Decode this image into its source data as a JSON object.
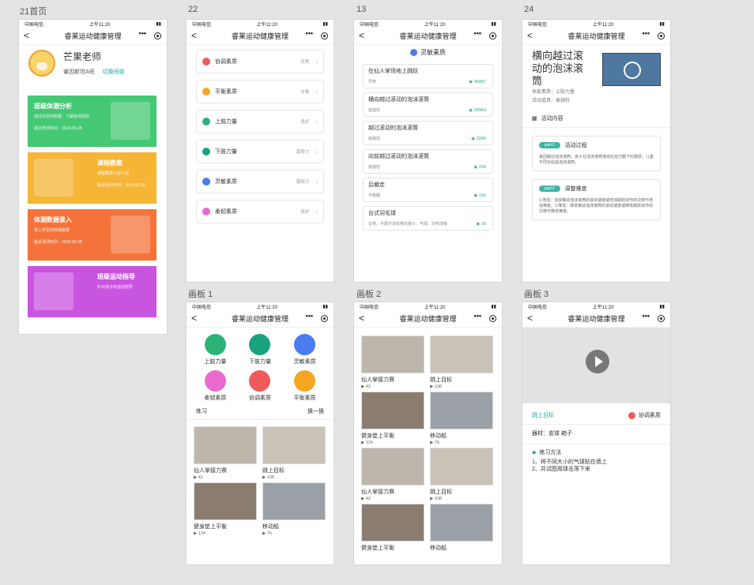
{
  "labels": {
    "home": "21首页",
    "p22": "22",
    "p13": "13",
    "p24": "24",
    "b1": "画板 1",
    "b2": "画板 2",
    "b3": "画板 3"
  },
  "status": {
    "carrier": "中国电信",
    "time": "上午11:20"
  },
  "nav": {
    "title": "睿莱运动健康管理",
    "back": "<",
    "more": "•••"
  },
  "home": {
    "teacher": "芒果老师",
    "class": "睿因斯坦A班",
    "switch": "切换班级",
    "cards": [
      {
        "title": "班级体测分析",
        "desc": "通过科学的数据，了解各项指标",
        "date": "最近测评时间：2018-05-28",
        "color": "#45c874"
      },
      {
        "title": "课程教案",
        "desc": "课程教案内容介绍",
        "date": "最近测评时间：2018-05-28",
        "color": "#f5b535"
      },
      {
        "title": "体测数据录入",
        "desc": "录入学生的体测数据",
        "date": "最近测评时间：2018-05-28",
        "color": "#f5733a"
      },
      {
        "title": "班级运动指导",
        "desc": "针对孩子的运动指导",
        "date": "",
        "color": "#c855e0"
      }
    ]
  },
  "p22": {
    "items": [
      {
        "name": "协调素质",
        "val": "优秀",
        "color": "#f05a5a"
      },
      {
        "name": "平衡素质",
        "val": "合格",
        "color": "#f5a623"
      },
      {
        "name": "上肢力量",
        "val": "良好",
        "color": "#2db37a"
      },
      {
        "name": "下肢力量",
        "val": "需努力",
        "color": "#1aa37f"
      },
      {
        "name": "灵敏素质",
        "val": "需努力",
        "color": "#4a7cf0"
      },
      {
        "name": "柔韧素质",
        "val": "良好",
        "color": "#e96bd0"
      }
    ]
  },
  "p13": {
    "title": "灵敏素质",
    "items": [
      {
        "t": "在仙人掌场地上跳跃",
        "s": "导类",
        "v": "46887"
      },
      {
        "t": "横向越过滚动的泡沫滚筒",
        "s": "瑜伽柱",
        "v": "38964"
      },
      {
        "t": "越过滚动的泡沫滚筒",
        "s": "瑜伽柱",
        "v": "2996"
      },
      {
        "t": "向前越过滚动的泡沫滚筒",
        "s": "瑜伽柱",
        "v": "234"
      },
      {
        "t": "后撤走",
        "s": "平衡圈",
        "v": "156"
      },
      {
        "t": "台式羽毛球",
        "s": "长凳、平展方块软带的帽子、气球、羽毛球板",
        "v": "39"
      }
    ]
  },
  "p24": {
    "title": "横向越过滚动的泡沫滚筒",
    "meta1": "体能素质：上肢力量",
    "meta2": "活动道具：瑜伽柱",
    "sec": "活动内容",
    "parts": [
      {
        "tag": "part1",
        "name": "活动过程",
        "desc": "来回跳动泡沫滚筒，孩子在泡沫滚筒滚动在自己脚下时跳跃，儿童不同手段提泡沫滚筒。"
      },
      {
        "tag": "part2",
        "name": "调整难度",
        "desc": "1.增加：加快推动泡沫滚筒的滚动速度或增加跳跃动作的次数可增加难度。2.降低：降低推动泡沫滚筒的滚动速度或降低跳跃动作的次数可降低难度。"
      }
    ]
  },
  "b1": {
    "icons": [
      {
        "n": "上肢力量",
        "c": "#2db37a"
      },
      {
        "n": "下肢力量",
        "c": "#1aa37f"
      },
      {
        "n": "灵敏素质",
        "c": "#4a7cf0"
      },
      {
        "n": "柔韧素质",
        "c": "#e96bd0"
      },
      {
        "n": "协调素质",
        "c": "#f05a5a"
      },
      {
        "n": "平衡素质",
        "c": "#f5a623"
      }
    ],
    "prac": "练习",
    "refresh": "换一换",
    "videos": [
      {
        "t": "仙人掌接力赛",
        "n": "42"
      },
      {
        "t": "跳上目标",
        "n": "108"
      },
      {
        "t": "健身垫上平衡",
        "n": "124"
      },
      {
        "t": "移动船",
        "n": "76"
      }
    ]
  },
  "b2": {
    "videos": [
      {
        "t": "仙人掌接力赛",
        "n": "42"
      },
      {
        "t": "跳上目标",
        "n": "108"
      },
      {
        "t": "健身垫上平衡",
        "n": "124"
      },
      {
        "t": "移动船",
        "n": "76"
      },
      {
        "t": "仙人掌接力赛",
        "n": "42"
      },
      {
        "t": "跳上目标",
        "n": "108"
      },
      {
        "t": "健身垫上平衡",
        "n": ""
      },
      {
        "t": "移动船",
        "n": ""
      }
    ]
  },
  "b3": {
    "name": "跳上目标",
    "tag": "协调素质",
    "equip": "器材：皮球 箱子",
    "method": "练习方法",
    "steps": "1、将不同大小的气球贴在墙上\n2、并试图用球击落下来"
  }
}
